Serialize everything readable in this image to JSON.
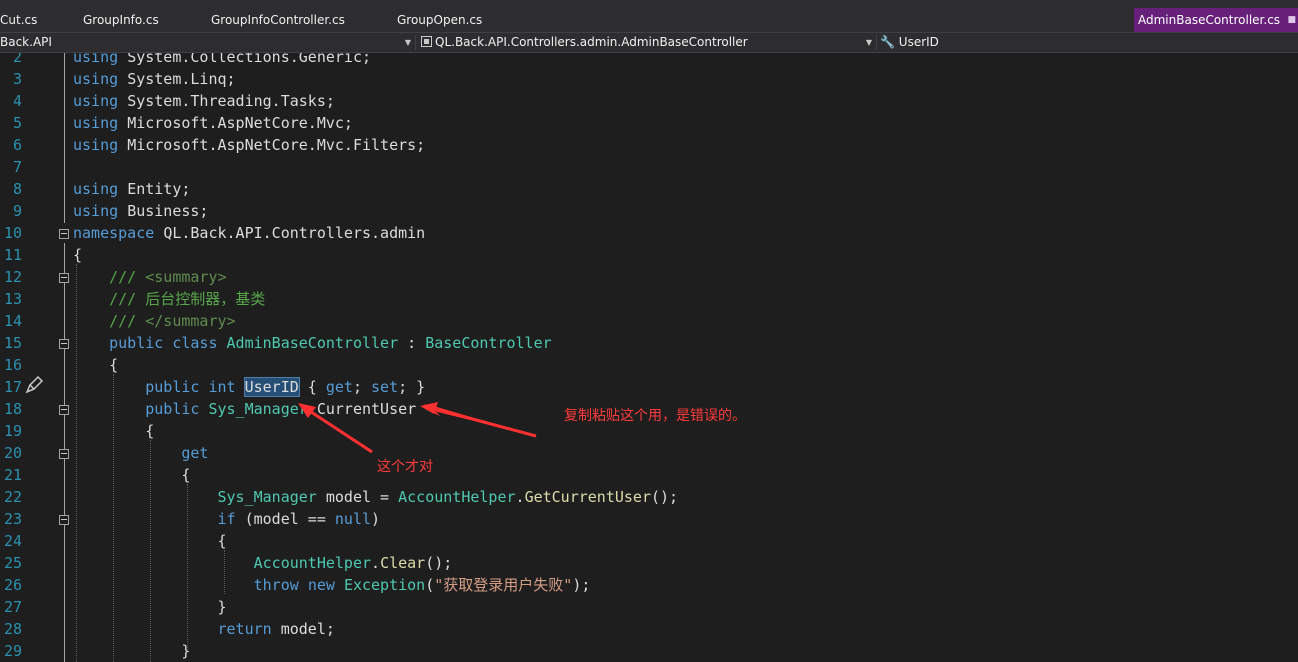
{
  "tabs": [
    {
      "label": "Cut.cs",
      "active": false
    },
    {
      "label": "GroupInfo.cs",
      "active": false
    },
    {
      "label": "GroupInfoController.cs",
      "active": false
    },
    {
      "label": "GroupOpen.cs",
      "active": false
    },
    {
      "label": "AdminBaseController.cs",
      "active": true
    }
  ],
  "navbar": {
    "project": "Back.API",
    "type": "QL.Back.API.Controllers.admin.AdminBaseController",
    "member": "UserID"
  },
  "editor": {
    "line_numbers": [
      "2",
      "3",
      "4",
      "5",
      "6",
      "7",
      "8",
      "9",
      "10",
      "11",
      "12",
      "13",
      "14",
      "15",
      "16",
      "17",
      "18",
      "19",
      "20",
      "21",
      "22",
      "23",
      "24",
      "25",
      "26",
      "27",
      "28",
      "29"
    ],
    "lines": [
      [
        {
          "t": "using ",
          "c": "kw"
        },
        {
          "t": "System.Collections.Generic;",
          "c": "pr"
        }
      ],
      [
        {
          "t": "using ",
          "c": "kw"
        },
        {
          "t": "System.Linq;",
          "c": "pr"
        }
      ],
      [
        {
          "t": "using ",
          "c": "kw"
        },
        {
          "t": "System.Threading.Tasks;",
          "c": "pr"
        }
      ],
      [
        {
          "t": "using ",
          "c": "kw"
        },
        {
          "t": "Microsoft.AspNetCore.Mvc;",
          "c": "pr"
        }
      ],
      [
        {
          "t": "using ",
          "c": "kw"
        },
        {
          "t": "Microsoft.AspNetCore.Mvc.Filters;",
          "c": "pr"
        }
      ],
      [],
      [
        {
          "t": "using ",
          "c": "kw"
        },
        {
          "t": "Entity;",
          "c": "pr"
        }
      ],
      [
        {
          "t": "using ",
          "c": "kw"
        },
        {
          "t": "Business;",
          "c": "pr"
        }
      ],
      [
        {
          "t": "namespace ",
          "c": "kw"
        },
        {
          "t": "QL.Back.API.Controllers.admin",
          "c": "pr"
        }
      ],
      [
        {
          "t": "{",
          "c": "pr"
        }
      ],
      [
        {
          "t": "    ",
          "c": "pr"
        },
        {
          "t": "/// ",
          "c": "cm"
        },
        {
          "t": "<summary>",
          "c": "xml"
        }
      ],
      [
        {
          "t": "    ",
          "c": "pr"
        },
        {
          "t": "/// 后台控制器，基类",
          "c": "cm"
        }
      ],
      [
        {
          "t": "    ",
          "c": "pr"
        },
        {
          "t": "/// ",
          "c": "cm"
        },
        {
          "t": "</summary>",
          "c": "xml"
        }
      ],
      [
        {
          "t": "    ",
          "c": "pr"
        },
        {
          "t": "public ",
          "c": "kw"
        },
        {
          "t": "class ",
          "c": "kw"
        },
        {
          "t": "AdminBaseController",
          "c": "ty"
        },
        {
          "t": " : ",
          "c": "pr"
        },
        {
          "t": "BaseController",
          "c": "ty"
        }
      ],
      [
        {
          "t": "    {",
          "c": "pr"
        }
      ],
      [
        {
          "t": "        ",
          "c": "pr"
        },
        {
          "t": "public ",
          "c": "kw"
        },
        {
          "t": "int ",
          "c": "kw"
        },
        {
          "t": "UserID",
          "c": "pr hl"
        },
        {
          "t": " { ",
          "c": "pr"
        },
        {
          "t": "get",
          "c": "kw"
        },
        {
          "t": "; ",
          "c": "pr"
        },
        {
          "t": "set",
          "c": "kw"
        },
        {
          "t": "; }",
          "c": "pr"
        }
      ],
      [
        {
          "t": "        ",
          "c": "pr"
        },
        {
          "t": "public ",
          "c": "kw"
        },
        {
          "t": "Sys_Manager",
          "c": "ty"
        },
        {
          "t": " CurrentUser",
          "c": "pr"
        }
      ],
      [
        {
          "t": "        {",
          "c": "pr"
        }
      ],
      [
        {
          "t": "            ",
          "c": "pr"
        },
        {
          "t": "get",
          "c": "kw"
        }
      ],
      [
        {
          "t": "            {",
          "c": "pr"
        }
      ],
      [
        {
          "t": "                ",
          "c": "pr"
        },
        {
          "t": "Sys_Manager",
          "c": "ty"
        },
        {
          "t": " model = ",
          "c": "pr"
        },
        {
          "t": "AccountHelper",
          "c": "ty"
        },
        {
          "t": ".",
          "c": "pr"
        },
        {
          "t": "GetCurrentUser",
          "c": "fn"
        },
        {
          "t": "();",
          "c": "pr"
        }
      ],
      [
        {
          "t": "                ",
          "c": "pr"
        },
        {
          "t": "if ",
          "c": "kw"
        },
        {
          "t": "(model == ",
          "c": "pr"
        },
        {
          "t": "null",
          "c": "kw"
        },
        {
          "t": ")",
          "c": "pr"
        }
      ],
      [
        {
          "t": "                {",
          "c": "pr"
        }
      ],
      [
        {
          "t": "                    ",
          "c": "pr"
        },
        {
          "t": "AccountHelper",
          "c": "ty"
        },
        {
          "t": ".",
          "c": "pr"
        },
        {
          "t": "Clear",
          "c": "fn"
        },
        {
          "t": "();",
          "c": "pr"
        }
      ],
      [
        {
          "t": "                    ",
          "c": "pr"
        },
        {
          "t": "throw ",
          "c": "kw"
        },
        {
          "t": "new ",
          "c": "kw"
        },
        {
          "t": "Exception",
          "c": "ty"
        },
        {
          "t": "(",
          "c": "pr"
        },
        {
          "t": "\"获取登录用户失败\"",
          "c": "str"
        },
        {
          "t": ");",
          "c": "pr"
        }
      ],
      [
        {
          "t": "                }",
          "c": "pr"
        }
      ],
      [
        {
          "t": "                ",
          "c": "pr"
        },
        {
          "t": "return ",
          "c": "kw"
        },
        {
          "t": "model;",
          "c": "pr"
        }
      ],
      [
        {
          "t": "            }",
          "c": "pr"
        }
      ]
    ]
  },
  "annotations": {
    "wrong": "复制粘贴这个用，是错误的。",
    "right": "这个才对"
  },
  "colors": {
    "background": "#1e1e1e",
    "tab_active": "#68217a",
    "keyword": "#569cd6",
    "type": "#4ec9b0",
    "comment": "#57a64a",
    "string": "#d69d85",
    "method": "#dcdcaa",
    "line_number": "#2b91af",
    "annotation": "#ff3b3b"
  }
}
